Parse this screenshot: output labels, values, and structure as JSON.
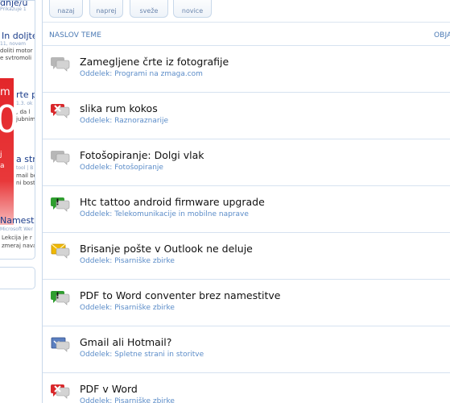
{
  "toolbar": {
    "buttons": [
      {
        "label": "nazaj",
        "icon": "back-icon"
      },
      {
        "label": "naprej",
        "icon": "forward-icon"
      },
      {
        "label": "sveže",
        "icon": "refresh-icon"
      },
      {
        "label": "novice",
        "icon": "news-icon"
      }
    ]
  },
  "columns": {
    "topic": "NASLOV TEME",
    "published": "OBJA"
  },
  "sidebar": {
    "lines": [
      {
        "text": "dnje/u",
        "kind": "title"
      },
      {
        "text": "Prikazuje 1",
        "kind": "meta"
      },
      {
        "text": "In doljte",
        "kind": "title"
      },
      {
        "text": "11, novem",
        "kind": "meta"
      },
      {
        "text": "doliti motor",
        "kind": "body"
      },
      {
        "text": "e svtromoli",
        "kind": "body"
      },
      {
        "text": "rte p",
        "kind": "title"
      },
      {
        "text": "1.3. ok",
        "kind": "meta"
      },
      {
        "text": ", da l",
        "kind": "body"
      },
      {
        "text": "jubnim",
        "kind": "body"
      },
      {
        "text": "a stra",
        "kind": "title"
      },
      {
        "text": "tool | B",
        "kind": "meta"
      },
      {
        "text": "mail boste",
        "kind": "body"
      },
      {
        "text": "ni boste",
        "kind": "body"
      },
      {
        "text": "Namestit",
        "kind": "title"
      },
      {
        "text": "Microsoft Wer",
        "kind": "meta"
      },
      {
        "text": "Lekcija je r",
        "kind": "body"
      },
      {
        "text": "zmeraj naval",
        "kind": "body"
      }
    ],
    "promo": {
      "m": "m",
      "big": "0",
      "line1": "j",
      "line2": "a"
    }
  },
  "topics": [
    {
      "title": "Zamegljene črte iz fotografije",
      "section": "Oddelek: Programi na zmaga.com",
      "icon": "topic-read-icon",
      "status": "read"
    },
    {
      "title": "slika rum kokos",
      "section": "Oddelek: Raznoraznarije",
      "icon": "topic-locked-icon",
      "status": "locked"
    },
    {
      "title": "Fotošopiranje: Dolgi vlak",
      "section": "Oddelek: Fotošopiranje",
      "icon": "topic-read-icon",
      "status": "read"
    },
    {
      "title": "Htc tattoo android firmware upgrade",
      "section": "Oddelek: Telekomunikacije in mobilne naprave",
      "icon": "topic-new-icon",
      "status": "new"
    },
    {
      "title": "Brisanje pošte v Outlook ne deluje",
      "section": "Oddelek: Pisarniške zbirke",
      "icon": "topic-mail-icon",
      "status": "mail"
    },
    {
      "title": "PDF to Word conventer brez namestitve",
      "section": "Oddelek: Pisarniške zbirke",
      "icon": "topic-new-icon",
      "status": "new"
    },
    {
      "title": "Gmail ali Hotmail?",
      "section": "Oddelek: Spletne strani in storitve",
      "icon": "topic-web-icon",
      "status": "web"
    },
    {
      "title": "PDF v Word",
      "section": "Oddelek: Pisarniške zbirke",
      "icon": "topic-locked-icon",
      "status": "locked"
    }
  ],
  "colors": {
    "link": "#5b8cc8",
    "border": "#d6e2f0",
    "header": "#4a79b4",
    "bubble_gray": "#b7b7b7",
    "bubble_red": "#d9282b",
    "bubble_green": "#2f9e2f",
    "envelope": "#f0b800"
  }
}
